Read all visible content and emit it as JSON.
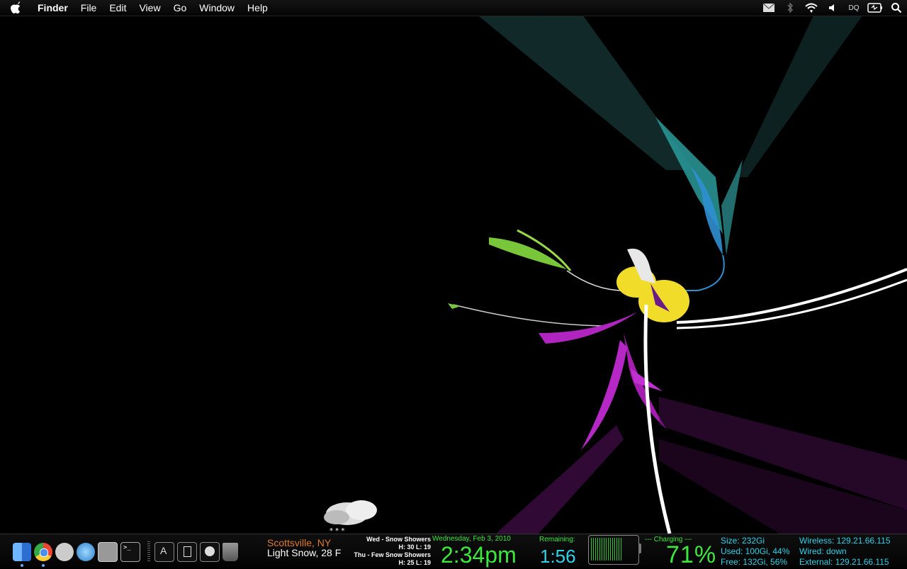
{
  "menubar": {
    "app_name": "Finder",
    "items": [
      "File",
      "Edit",
      "View",
      "Go",
      "Window",
      "Help"
    ],
    "status_text": "DQ"
  },
  "icons": {
    "apple": "apple-icon",
    "mail": "mail-icon",
    "bluetooth": "bluetooth-icon",
    "wifi": "wifi-icon",
    "volume": "volume-icon",
    "battery": "battery-icon",
    "search": "spotlight-search-icon"
  },
  "weather": {
    "city": "Scottsville, NY",
    "current": "Light Snow, 28 F",
    "forecast": [
      {
        "line1": "Wed - Snow Showers",
        "line2": "H: 30  L: 19"
      },
      {
        "line1": "Thu - Few Snow Showers",
        "line2": "H: 25  L: 19"
      }
    ]
  },
  "clock": {
    "date": "Wednesday, Feb 3, 2010",
    "time": "2:34pm"
  },
  "battery": {
    "remaining_label": "Remaining:",
    "remaining_value": "1:56",
    "charging_label": "--- Charging ---",
    "percent_text": "71%",
    "level": 0.71
  },
  "disk": {
    "size": "Size: 232Gi",
    "used": "Used: 100Gi, 44%",
    "free": "Free: 132Gi, 56%"
  },
  "network": {
    "wireless": "Wireless: 129.21.66.115",
    "wired": "Wired: down",
    "external": "External: 129.21.66.115"
  },
  "colors": {
    "accent_green": "#3ce63c",
    "accent_cyan": "#2fd2e8",
    "accent_orange": "#e07a2a"
  },
  "dock": [
    {
      "name": "finder-dock-icon",
      "color": "#3a7bd5"
    },
    {
      "name": "chrome-dock-icon",
      "color": "#d44"
    },
    {
      "name": "ichat-dock-icon",
      "color": "#bbb"
    },
    {
      "name": "itunes-dock-icon",
      "color": "#4aa3e0"
    },
    {
      "name": "system-preferences-dock-icon",
      "color": "#888"
    },
    {
      "name": "terminal-dock-icon",
      "color": "#222"
    }
  ]
}
